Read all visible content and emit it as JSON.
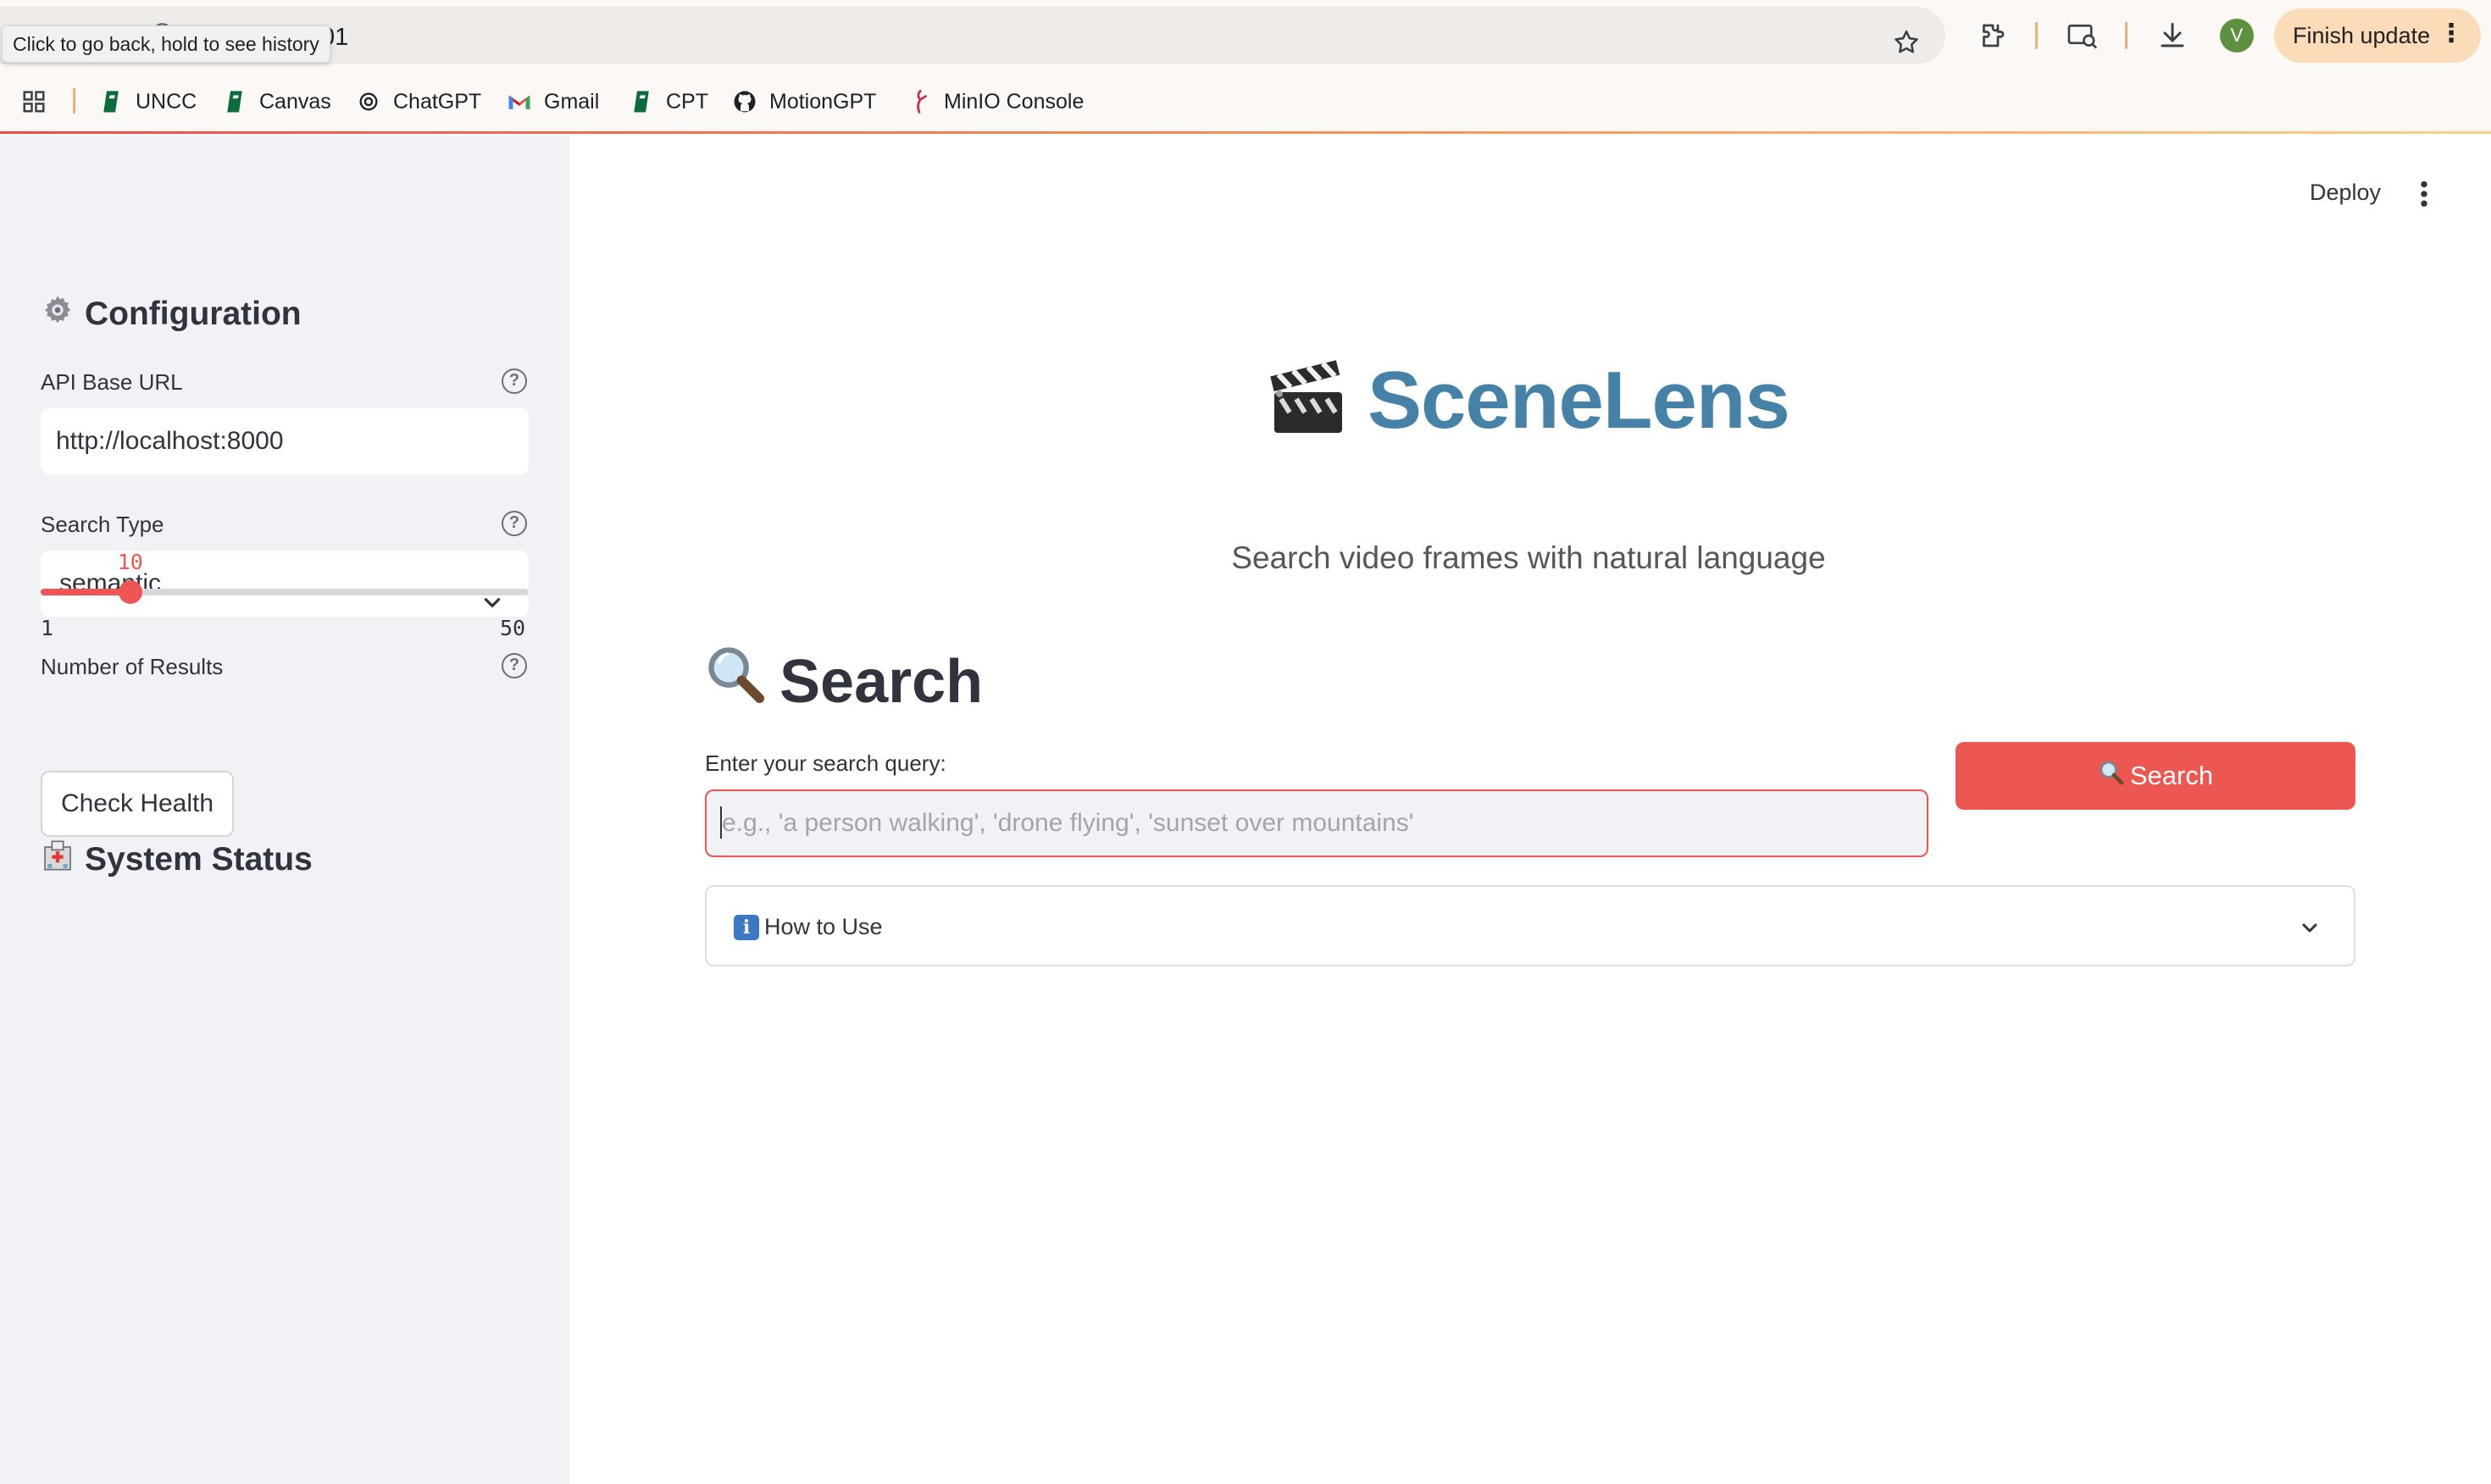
{
  "browser": {
    "url_visible_tail": "ost:8501",
    "nav_ghost": "C",
    "tooltip": "Click to go back, hold to see history",
    "avatar_letter": "V",
    "finish_update_label": "Finish update",
    "accent_color": "#fbdcb9"
  },
  "bookmarks": [
    {
      "label": "UNCC",
      "icon": "uncc-icon"
    },
    {
      "label": "Canvas",
      "icon": "canvas-icon"
    },
    {
      "label": "ChatGPT",
      "icon": "chatgpt-icon"
    },
    {
      "label": "Gmail",
      "icon": "gmail-icon"
    },
    {
      "label": "CPT",
      "icon": "cpt-icon"
    },
    {
      "label": "MotionGPT",
      "icon": "github-icon"
    },
    {
      "label": "MinIO Console",
      "icon": "minio-icon"
    }
  ],
  "sidebar": {
    "config_header": "Configuration",
    "api_label": "API Base URL",
    "api_value": "http://localhost:8000",
    "search_type_label": "Search Type",
    "search_type_value": "semantic",
    "results_label": "Number of Results",
    "results_value": "10",
    "results_min": "1",
    "results_max": "50",
    "status_header": "System Status",
    "health_button": "Check Health"
  },
  "header": {
    "deploy_label": "Deploy"
  },
  "main": {
    "title": "SceneLens",
    "subtitle": "Search video frames with natural language",
    "search_header": "Search",
    "query_label": "Enter your search query:",
    "query_placeholder": "e.g., 'a person walking', 'drone flying', 'sunset over mountains'",
    "search_button": "Search",
    "expander_label": "How to Use"
  },
  "colors": {
    "primary": "#ef5552",
    "title": "#4682a8",
    "sidebar_bg": "#f0f2f6"
  }
}
